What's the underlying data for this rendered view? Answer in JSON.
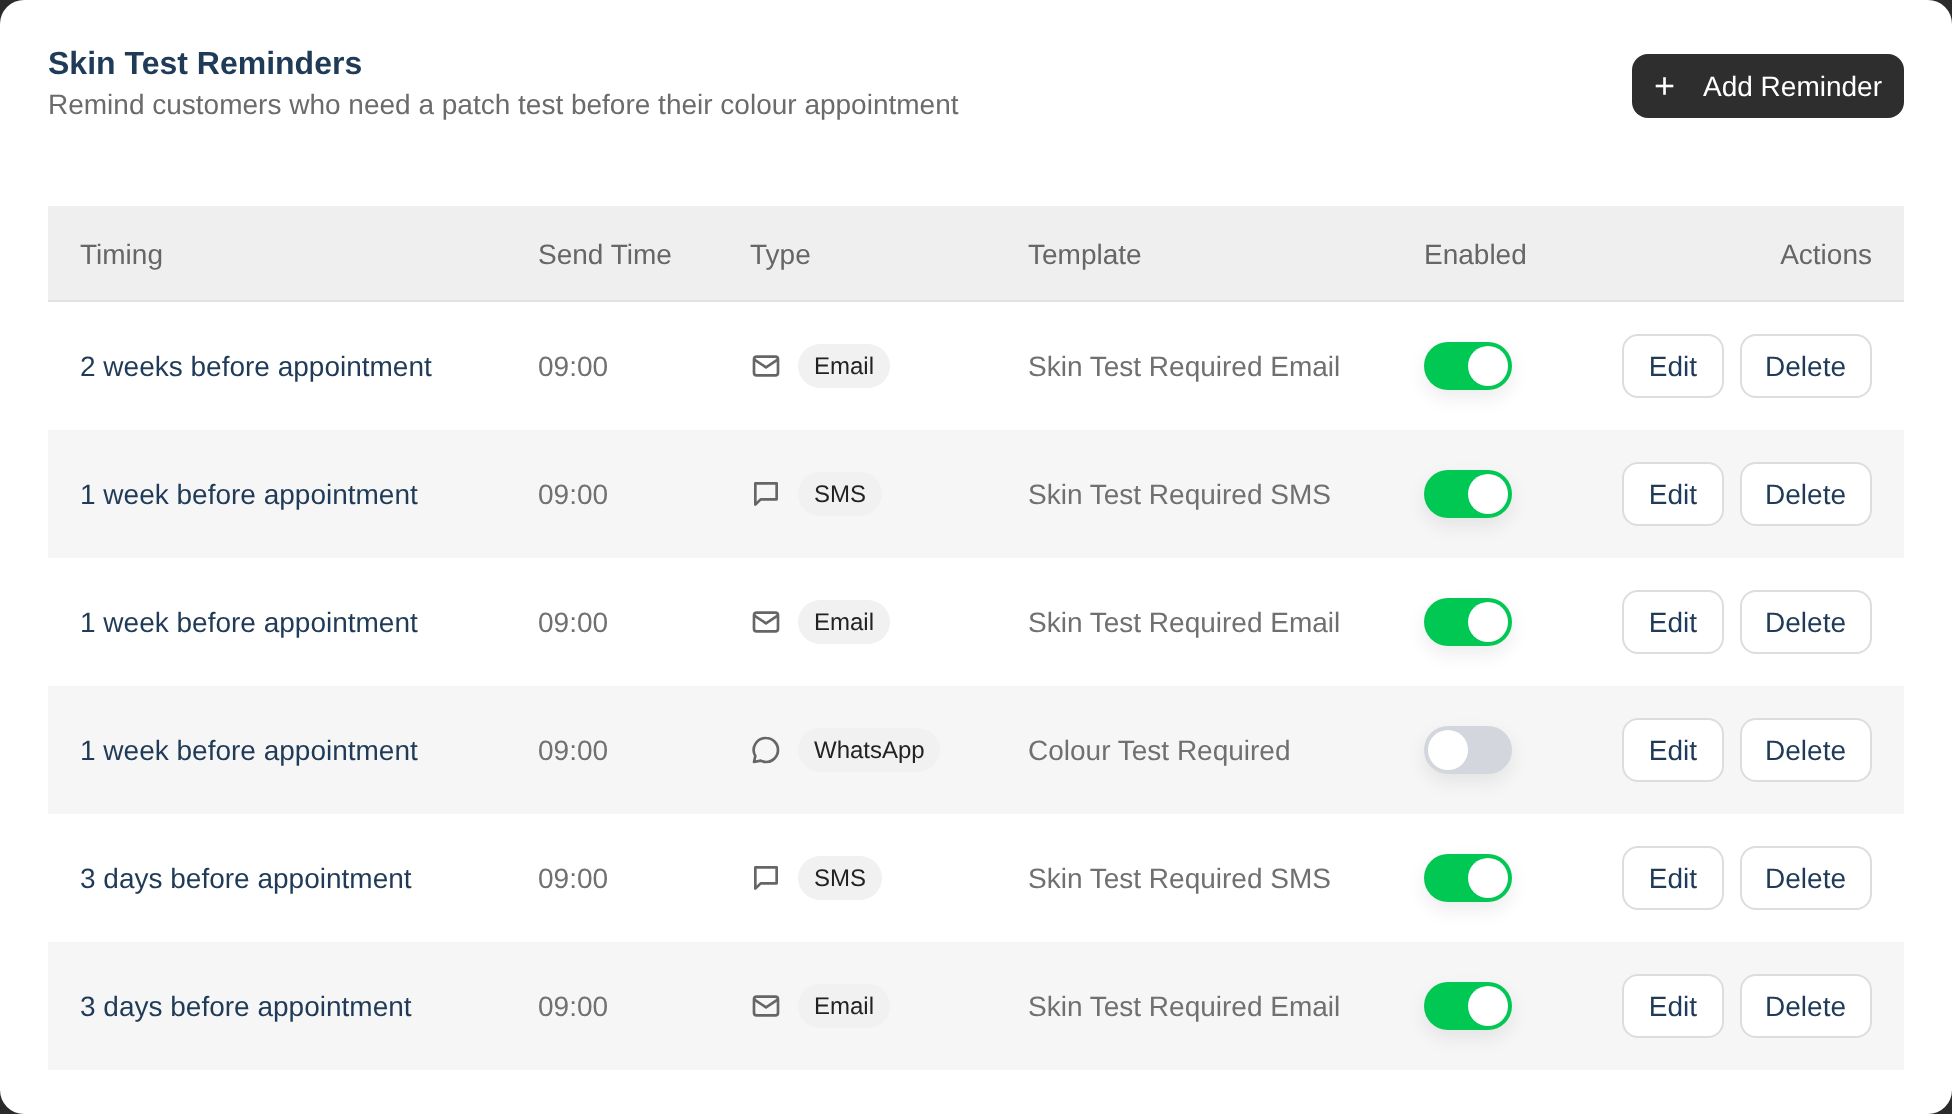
{
  "header": {
    "title": "Skin Test Reminders",
    "subtitle": "Remind customers who need a patch test before their colour appointment",
    "add_button": {
      "icon": "+",
      "label": "Add Reminder"
    }
  },
  "table": {
    "columns": [
      "Timing",
      "Send Time",
      "Type",
      "Template",
      "Enabled",
      "Actions"
    ],
    "rows": [
      {
        "timing": "2 weeks before appointment",
        "send_time": "09:00",
        "type": {
          "kind": "email",
          "label": "Email"
        },
        "template": "Skin Test Required Email",
        "enabled": true,
        "actions": [
          "Edit",
          "Delete"
        ]
      },
      {
        "timing": "1 week before appointment",
        "send_time": "09:00",
        "type": {
          "kind": "sms",
          "label": "SMS"
        },
        "template": "Skin Test Required SMS",
        "enabled": true,
        "actions": [
          "Edit",
          "Delete"
        ]
      },
      {
        "timing": "1 week before appointment",
        "send_time": "09:00",
        "type": {
          "kind": "email",
          "label": "Email"
        },
        "template": "Skin Test Required Email",
        "enabled": true,
        "actions": [
          "Edit",
          "Delete"
        ]
      },
      {
        "timing": "1 week before appointment",
        "send_time": "09:00",
        "type": {
          "kind": "whatsapp",
          "label": "WhatsApp"
        },
        "template": "Colour Test Required",
        "enabled": false,
        "actions": [
          "Edit",
          "Delete"
        ]
      },
      {
        "timing": "3 days before appointment",
        "send_time": "09:00",
        "type": {
          "kind": "sms",
          "label": "SMS"
        },
        "template": "Skin Test Required SMS",
        "enabled": true,
        "actions": [
          "Edit",
          "Delete"
        ]
      },
      {
        "timing": "3 days before appointment",
        "send_time": "09:00",
        "type": {
          "kind": "email",
          "label": "Email"
        },
        "template": "Skin Test Required Email",
        "enabled": true,
        "actions": [
          "Edit",
          "Delete"
        ]
      }
    ]
  }
}
